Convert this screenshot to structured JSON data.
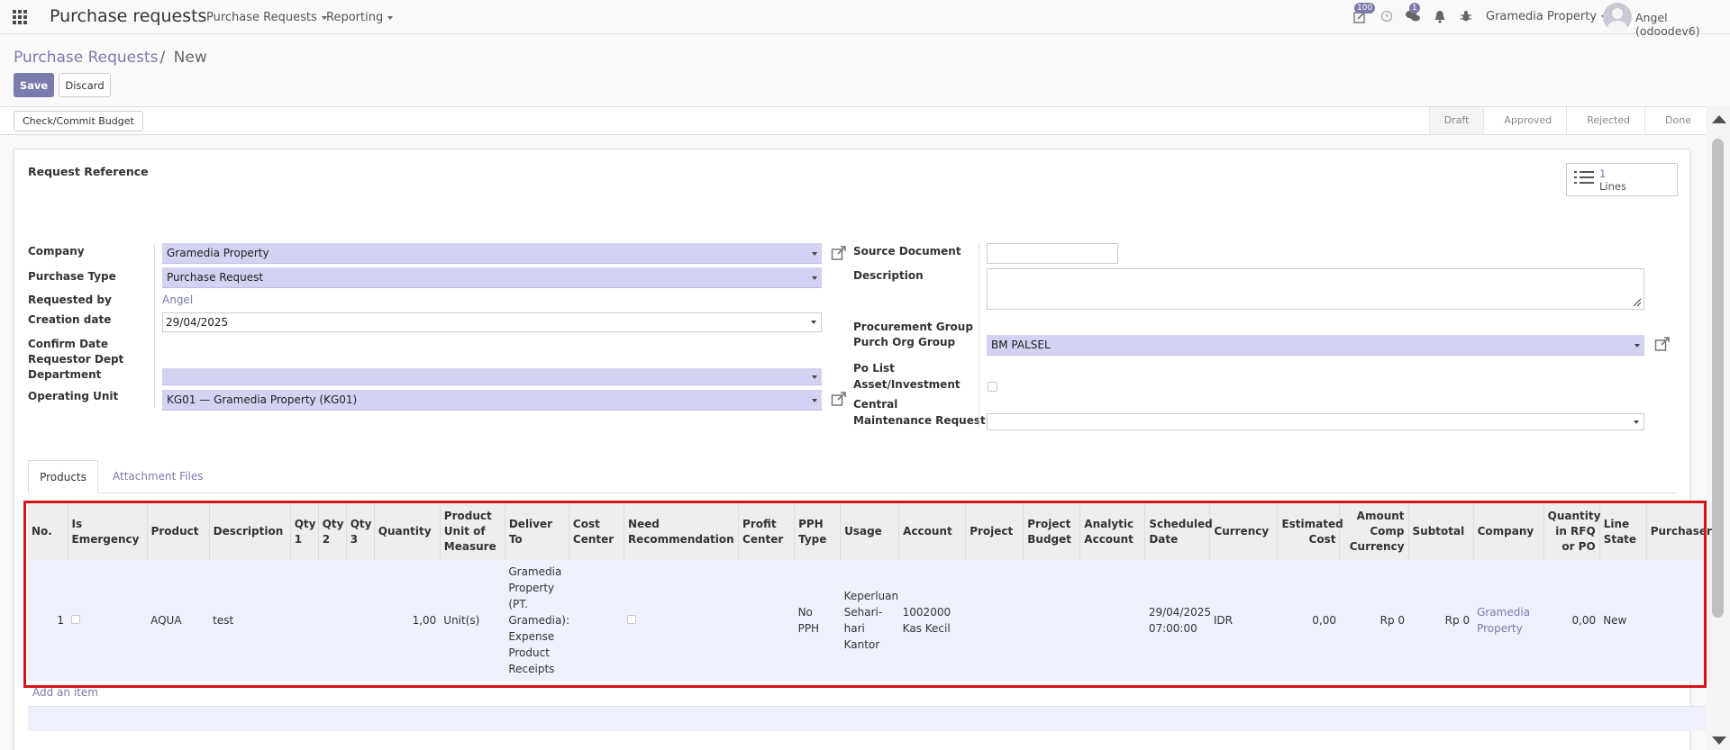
{
  "navbar": {
    "app_title": "Purchase requests",
    "menu": [
      "Purchase Requests",
      "Reporting"
    ],
    "activity_badge": "100",
    "messages_badge": "1",
    "company": "Gramedia Property",
    "user": "Angel (odoodev6)"
  },
  "breadcrumb": {
    "parent": "Purchase Requests",
    "separator": "/",
    "current": "New"
  },
  "buttons": {
    "save": "Save",
    "discard": "Discard",
    "check_budget": "Check/Commit Budget"
  },
  "statusbar": {
    "stages": [
      "Draft",
      "Approved",
      "Rejected",
      "Done"
    ],
    "active": "Draft"
  },
  "smart_button": {
    "value": "1",
    "label": "Lines"
  },
  "form": {
    "title": "Request Reference",
    "labels": {
      "company": "Company",
      "purchase_type": "Purchase Type",
      "requested_by": "Requested by",
      "creation_date": "Creation date",
      "confirm_date": "Confirm Date",
      "requestor_dept": "Requestor Dept",
      "department": "Department",
      "operating_unit": "Operating Unit",
      "source_document": "Source Document",
      "description": "Description",
      "procurement_group": "Procurement Group",
      "purch_org_group": "Purch Org Group",
      "po_list": "Po List",
      "asset_investment": "Asset/Investment",
      "central": "Central",
      "maintenance_request": "Maintenance Request"
    },
    "values": {
      "company": "Gramedia Property",
      "purchase_type": "Purchase Request",
      "requested_by": "Angel",
      "creation_date": "29/04/2025",
      "department": "",
      "operating_unit": "KG01 — Gramedia Property (KG01)",
      "source_document": "",
      "description": "",
      "purch_org_group": "BM PALSEL",
      "maintenance_request": ""
    }
  },
  "tabs": [
    "Products",
    "Attachment Files"
  ],
  "table": {
    "headers": [
      "No.",
      "Is Emergency",
      "Product",
      "Description",
      "Qty 1",
      "Qty 2",
      "Qty 3",
      "Quantity",
      "Product Unit of Measure",
      "Deliver To",
      "Cost Center",
      "Need Recommendation",
      "Profit Center",
      "PPH Type",
      "Usage",
      "Account",
      "Project",
      "Project Budget",
      "Analytic Account",
      "Scheduled Date",
      "Currency",
      "Estimated Cost",
      "Amount Comp Currency",
      "Subtotal",
      "Company",
      "Quantity in RFQ or PO",
      "Line State",
      "Purchaser"
    ],
    "rows": [
      {
        "no": "1",
        "product": "AQUA",
        "description": "test",
        "quantity": "1,00",
        "uom": "Unit(s)",
        "deliver_to": "Gramedia Property (PT. Gramedia): Expense Product Receipts",
        "pph_type": "No PPH",
        "usage": "Keperluan Sehari-hari Kantor",
        "account": "1002000 Kas Kecil",
        "scheduled_date": "29/04/2025 07:00:00",
        "currency": "IDR",
        "estimated_cost": "0,00",
        "amount_comp_currency": "Rp 0",
        "subtotal": "Rp 0",
        "company": "Gramedia Property",
        "qty_rfq_po": "0,00",
        "line_state": "New"
      }
    ],
    "add_item": "Add an item"
  },
  "colors": {
    "accent": "#7c7bad",
    "field_required": "#d3d2f3",
    "highlight": "#d8141b"
  }
}
